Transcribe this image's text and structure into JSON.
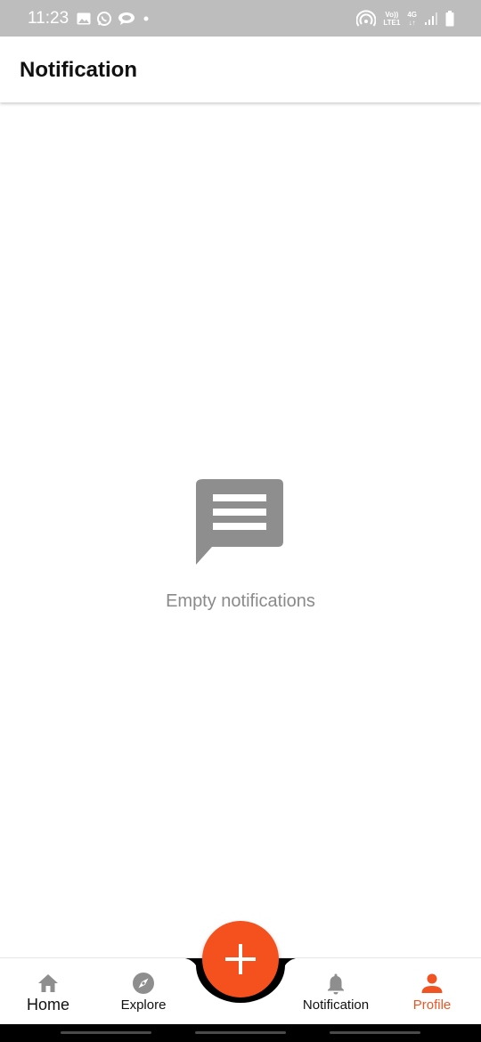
{
  "status_bar": {
    "time": "11:23",
    "left_icons": [
      "image-icon",
      "whatsapp-icon",
      "cloud-chat-icon",
      "dot-icon"
    ],
    "right_icons": [
      "hotspot-icon",
      "volte-icon",
      "4g-icon",
      "signal-icon",
      "battery-icon"
    ],
    "volte_top": "Vo))",
    "volte_bottom": "LTE1",
    "network_top": "4G",
    "network_bottom": "↓↑"
  },
  "header": {
    "title": "Notification"
  },
  "empty_state": {
    "icon": "message-icon",
    "text": "Empty notifications"
  },
  "bottom_nav": {
    "items": [
      {
        "label": "Home",
        "icon": "home-icon",
        "active": false
      },
      {
        "label": "Explore",
        "icon": "compass-icon",
        "active": false
      },
      {
        "label": "Notification",
        "icon": "bell-icon",
        "active": false
      },
      {
        "label": "Profile",
        "icon": "person-icon",
        "active": true
      }
    ],
    "fab_icon": "plus-icon"
  },
  "colors": {
    "accent": "#f4511e",
    "active_label": "#f05423",
    "icon_gray": "#8e8e8e",
    "status_bar": "#bdbdbd",
    "text_muted": "#8a8a8a"
  }
}
